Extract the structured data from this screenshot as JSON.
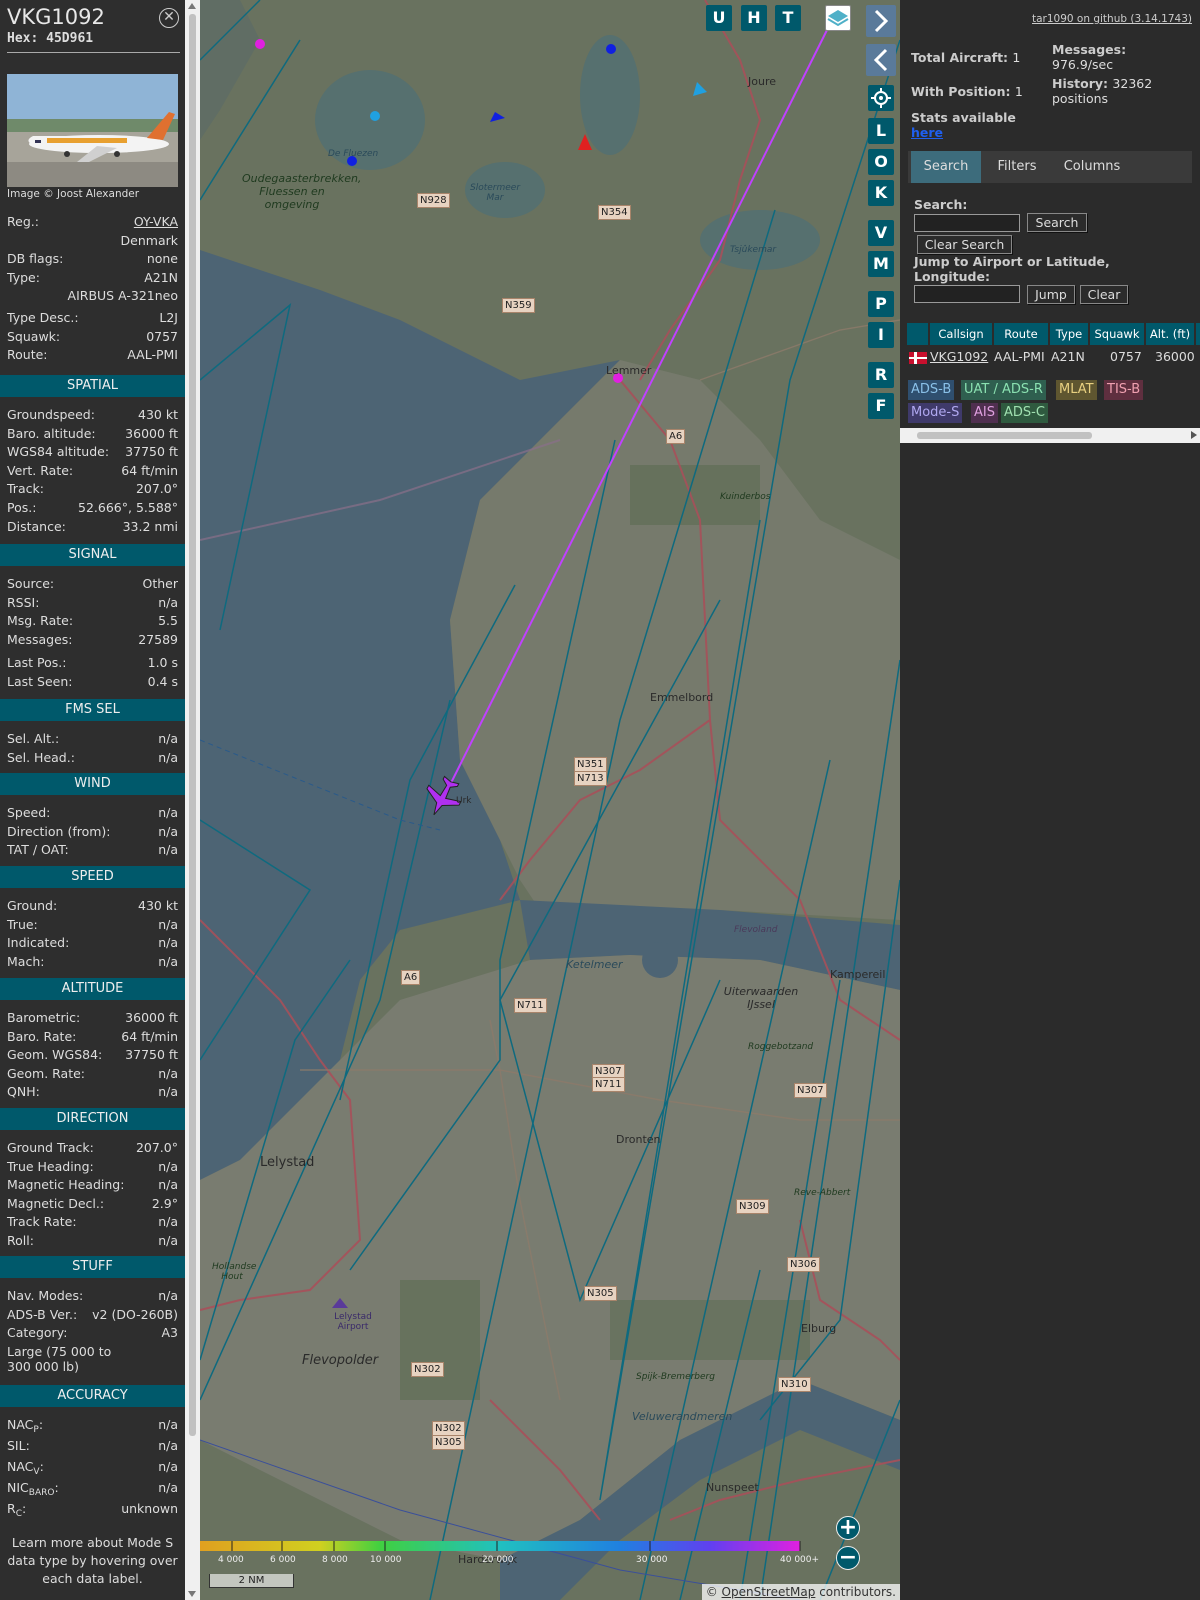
{
  "aircraft": {
    "callsign": "VKG1092",
    "hex_label": "Hex:",
    "hex": "45D961",
    "photo_credit": "Image © Joost Alexander"
  },
  "info_rows": [
    {
      "k": "Reg.:",
      "v": "OY-VKA"
    },
    {
      "k": "",
      "v": "Denmark"
    },
    {
      "k": "DB flags:",
      "v": "none"
    },
    {
      "k": "Type:",
      "v": "A21N"
    },
    {
      "k": "",
      "v": "AIRBUS A-321neo"
    },
    {
      "k": "Type Desc.:",
      "v": "L2J"
    },
    {
      "k": "Squawk:",
      "v": "0757"
    },
    {
      "k": "Route:",
      "v": "AAL-PMI"
    }
  ],
  "sections": {
    "spatial": "SPATIAL",
    "signal": "SIGNAL",
    "fms_sel": "FMS SEL",
    "wind": "WIND",
    "speed": "SPEED",
    "altitude": "ALTITUDE",
    "direction": "DIRECTION",
    "stuff": "STUFF",
    "accuracy": "ACCURACY"
  },
  "spatial": [
    {
      "k": "Groundspeed:",
      "v": "430 kt"
    },
    {
      "k": "Baro. altitude:",
      "v": "36000 ft"
    },
    {
      "k": "WGS84 altitude:",
      "v": "37750 ft"
    },
    {
      "k": "Vert. Rate:",
      "v": "64 ft/min"
    },
    {
      "k": "Track:",
      "v": "207.0°"
    },
    {
      "k": "Pos.:",
      "v": "52.666°, 5.588°"
    },
    {
      "k": "Distance:",
      "v": "33.2 nmi"
    }
  ],
  "signal": [
    {
      "k": "Source:",
      "v": "Other"
    },
    {
      "k": "RSSI:",
      "v": "n/a"
    },
    {
      "k": "Msg. Rate:",
      "v": "5.5"
    },
    {
      "k": "Messages:",
      "v": "27589"
    },
    {
      "k": "Last Pos.:",
      "v": "1.0 s"
    },
    {
      "k": "Last Seen:",
      "v": "0.4 s"
    }
  ],
  "fms_sel": [
    {
      "k": "Sel. Alt.:",
      "v": "n/a"
    },
    {
      "k": "Sel. Head.:",
      "v": "n/a"
    }
  ],
  "wind": [
    {
      "k": "Speed:",
      "v": "n/a"
    },
    {
      "k": "Direction (from):",
      "v": "n/a"
    },
    {
      "k": "TAT / OAT:",
      "v": "n/a"
    }
  ],
  "speed": [
    {
      "k": "Ground:",
      "v": "430 kt"
    },
    {
      "k": "True:",
      "v": "n/a"
    },
    {
      "k": "Indicated:",
      "v": "n/a"
    },
    {
      "k": "Mach:",
      "v": "n/a"
    }
  ],
  "altitude": [
    {
      "k": "Barometric:",
      "v": "36000 ft"
    },
    {
      "k": "Baro. Rate:",
      "v": "64 ft/min"
    },
    {
      "k": "Geom. WGS84:",
      "v": "37750 ft"
    },
    {
      "k": "Geom. Rate:",
      "v": "n/a"
    },
    {
      "k": "QNH:",
      "v": "n/a"
    }
  ],
  "direction": [
    {
      "k": "Ground Track:",
      "v": "207.0°"
    },
    {
      "k": "True Heading:",
      "v": "n/a"
    },
    {
      "k": "Magnetic Heading:",
      "v": "n/a"
    },
    {
      "k": "Magnetic Decl.:",
      "v": "2.9°"
    },
    {
      "k": "Track Rate:",
      "v": "n/a"
    },
    {
      "k": "Roll:",
      "v": "n/a"
    }
  ],
  "stuff": [
    {
      "k": "Nav. Modes:",
      "v": "n/a"
    },
    {
      "k": "ADS-B Ver.:",
      "v": "v2 (DO-260B)"
    },
    {
      "k": "Category:",
      "v": "A3"
    }
  ],
  "stuff_category_desc": "Large (75 000 to 300 000 lb)",
  "accuracy": [
    {
      "k": "NAC",
      "sub": "P",
      "v": "n/a"
    },
    {
      "k": "SIL:",
      "sub": "",
      "v": "n/a"
    },
    {
      "k": "NAC",
      "sub": "V",
      "v": "n/a"
    },
    {
      "k": "NIC",
      "sub": "BARO",
      "v": "n/a"
    },
    {
      "k": "R",
      "sub": "C",
      "v": "unknown"
    }
  ],
  "footer_text": "Learn more about Mode S data type by hovering over each data label.",
  "map": {
    "buttons": [
      "U",
      "H",
      "T"
    ],
    "side_buttons": [
      "L",
      "O",
      "K",
      "V",
      "M",
      "P",
      "I",
      "R",
      "F"
    ],
    "places": [
      {
        "name": "Joure"
      },
      {
        "name": "Lemmer"
      },
      {
        "name": "Emmelbord"
      },
      {
        "name": "Lelystad"
      },
      {
        "name": "Dronten"
      },
      {
        "name": "Flevopolder"
      },
      {
        "name": "Elburg"
      },
      {
        "name": "Nunspeet"
      },
      {
        "name": "Harderwijk"
      },
      {
        "name": "Uiterwaarden IJssel"
      },
      {
        "name": "Kampereil"
      },
      {
        "name": "Oudegaasterbrekken, Fluessen en omgeving"
      },
      {
        "name": "De Fluezen"
      },
      {
        "name": "Slotermeer Mar"
      },
      {
        "name": "Ketelmeer"
      },
      {
        "name": "Veluwerandmeren"
      },
      {
        "name": "Lelystad Airport"
      },
      {
        "name": "Urk"
      },
      {
        "name": "Flevoland"
      },
      {
        "name": "Tsjûkemar"
      },
      {
        "name": "Kuinderbos"
      },
      {
        "name": "Roggebotzand"
      },
      {
        "name": "Reve-Abbert"
      },
      {
        "name": "Spijk-Bremerberg"
      },
      {
        "name": "Hollandse Hout"
      }
    ],
    "roads": [
      "N928",
      "N354",
      "N359",
      "A6",
      "N351",
      "N713",
      "A6",
      "N711",
      "N307",
      "N711",
      "N307",
      "N309",
      "N305",
      "N306",
      "N302",
      "N302",
      "N305",
      "N310"
    ],
    "altitude_scale": [
      "4 000",
      "6 000",
      "8 000",
      "10 000",
      "20 000",
      "30 000",
      "40 000+"
    ],
    "scale": "2 NM",
    "osm_credit_prefix": "© ",
    "osm_credit_link": "OpenStreetMap",
    "osm_credit_suffix": " contributors.",
    "zoom_in": "+",
    "zoom_out": "−"
  },
  "panel": {
    "github": "tar1090 on github (3.14.1743)",
    "total_aircraft_label": "Total Aircraft:",
    "total_aircraft": "1",
    "with_position_label": "With Position:",
    "with_position": "1",
    "messages_label": "Messages:",
    "messages_rate": "976.9/sec",
    "history_label": "History:",
    "history": "32362 positions",
    "stats_label": "Stats available",
    "stats_link": "here",
    "tabs": [
      "Search",
      "Filters",
      "Columns"
    ],
    "search_label": "Search:",
    "search_button": "Search",
    "clear_search_button": "Clear Search",
    "jump_label": "Jump to Airport or Latitude, Longitude:",
    "jump_button": "Jump",
    "clear_button": "Clear",
    "columns": [
      "Callsign",
      "Route",
      "Type",
      "Squawk",
      "Alt. (ft)"
    ],
    "row": {
      "callsign": "VKG1092",
      "route": "AAL-PMI",
      "type": "A21N",
      "squawk": "0757",
      "alt": "36000"
    },
    "sources": [
      {
        "label": "ADS-B",
        "color": "#2f4f6f"
      },
      {
        "label": "UAT / ADS-R",
        "color": "#2f5f4f"
      },
      {
        "label": "MLAT",
        "color": "#5f5630"
      },
      {
        "label": "TIS-B",
        "color": "#5f2f3f"
      },
      {
        "label": "Mode-S",
        "color": "#3f3a6a"
      },
      {
        "label": "AIS",
        "color": "#4f2f4f"
      },
      {
        "label": "ADS-C",
        "color": "#2f5a3f"
      }
    ]
  }
}
